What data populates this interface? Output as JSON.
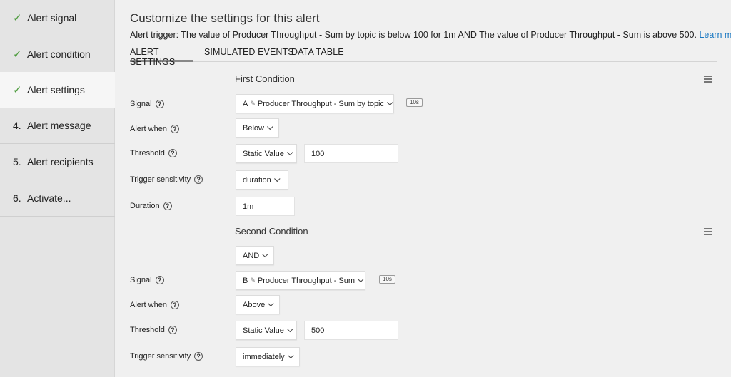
{
  "sidebar": {
    "steps": [
      {
        "num": "",
        "label": "Alert signal",
        "done": true
      },
      {
        "num": "",
        "label": "Alert condition",
        "done": true
      },
      {
        "num": "",
        "label": "Alert settings",
        "done": true,
        "active": true
      },
      {
        "num": "4.",
        "label": "Alert message",
        "done": false
      },
      {
        "num": "5.",
        "label": "Alert recipients",
        "done": false
      },
      {
        "num": "6.",
        "label": "Activate...",
        "done": false
      }
    ]
  },
  "header": {
    "title": "Customize the settings for this alert",
    "trigger_text": "Alert trigger: The value of Producer Throughput - Sum by topic is below 100 for 1m AND The value of Producer Throughput - Sum is above 500.",
    "learn_more": "Learn more"
  },
  "tabs": [
    "ALERT SETTINGS",
    "SIMULATED EVENTS",
    "DATA TABLE"
  ],
  "conditions": {
    "first": {
      "title": "First Condition",
      "signal_label": "Signal",
      "signal_letter": "A",
      "signal_name": "Producer Throughput - Sum by topic",
      "resolution": "10s",
      "alert_when_label": "Alert when",
      "alert_when": "Below",
      "threshold_label": "Threshold",
      "threshold_type": "Static Value",
      "threshold_value": "100",
      "sensitivity_label": "Trigger sensitivity",
      "sensitivity": "duration",
      "duration_label": "Duration",
      "duration": "1m"
    },
    "combiner": "AND",
    "second": {
      "title": "Second Condition",
      "signal_label": "Signal",
      "signal_letter": "B",
      "signal_name": "Producer Throughput - Sum",
      "resolution": "10s",
      "alert_when_label": "Alert when",
      "alert_when": "Above",
      "threshold_label": "Threshold",
      "threshold_type": "Static Value",
      "threshold_value": "500",
      "sensitivity_label": "Trigger sensitivity",
      "sensitivity": "immediately"
    }
  },
  "icons": {
    "check": "check-icon",
    "help": "question-circle-icon",
    "menu": "hamburger-menu-icon",
    "pencil": "pencil-icon",
    "chevron": "chevron-down-icon"
  },
  "colors": {
    "check": "#4a9a3a",
    "link": "#1a78c2"
  }
}
